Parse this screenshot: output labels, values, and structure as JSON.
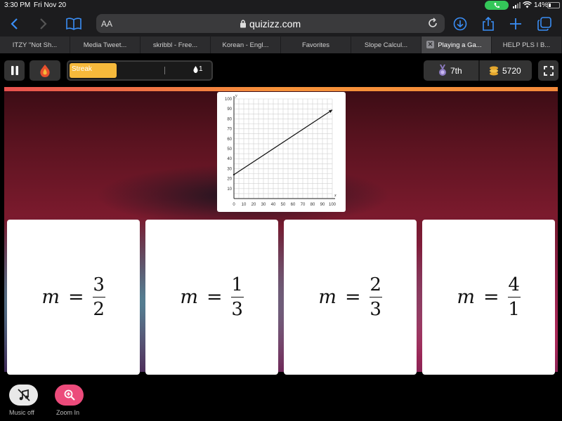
{
  "status_bar": {
    "time": "3:30 PM",
    "date": "Fri Nov 20",
    "battery": "14%"
  },
  "browser": {
    "text_size_label": "AA",
    "domain": "quizizz.com",
    "tabs": [
      {
        "label": "ITZY \"Not Sh...",
        "active": false
      },
      {
        "label": "Media Tweet...",
        "active": false
      },
      {
        "label": "skribbl - Free...",
        "active": false
      },
      {
        "label": "Korean - Engl...",
        "active": false
      },
      {
        "label": "Favorites",
        "active": false
      },
      {
        "label": "Slope Calcul...",
        "active": false
      },
      {
        "label": "Playing a Ga...",
        "active": true
      },
      {
        "label": "HELP PLS I B...",
        "active": false
      }
    ]
  },
  "game": {
    "streak_label": "Streak",
    "streak_count": "1",
    "streak_progress": 0.33,
    "rank": "7th",
    "coins": "5720"
  },
  "options": [
    {
      "var": "m",
      "numerator": "3",
      "denominator": "2"
    },
    {
      "var": "m",
      "numerator": "1",
      "denominator": "3"
    },
    {
      "var": "m",
      "numerator": "2",
      "denominator": "3"
    },
    {
      "var": "m",
      "numerator": "4",
      "denominator": "1"
    }
  ],
  "footer": {
    "music_label": "Music off",
    "zoom_label": "Zoom In"
  },
  "colors": {
    "accent_pink": "#ec4b7b",
    "streak_yellow": "#f6b93b",
    "rank_purple": "#8e7cc3",
    "coin_gold": "#e5a72d"
  },
  "chart_data": {
    "type": "line",
    "title": "",
    "xlabel": "x",
    "ylabel": "y",
    "xlim": [
      0,
      100
    ],
    "ylim": [
      0,
      100
    ],
    "xticks": [
      "0",
      "10",
      "20",
      "30",
      "40",
      "50",
      "60",
      "70",
      "80",
      "90",
      "100"
    ],
    "yticks": [
      "10",
      "20",
      "30",
      "40",
      "50",
      "60",
      "70",
      "80",
      "90",
      "100"
    ],
    "grid": true,
    "series": [
      {
        "x": [
          0,
          100
        ],
        "y": [
          24,
          89
        ]
      }
    ]
  }
}
